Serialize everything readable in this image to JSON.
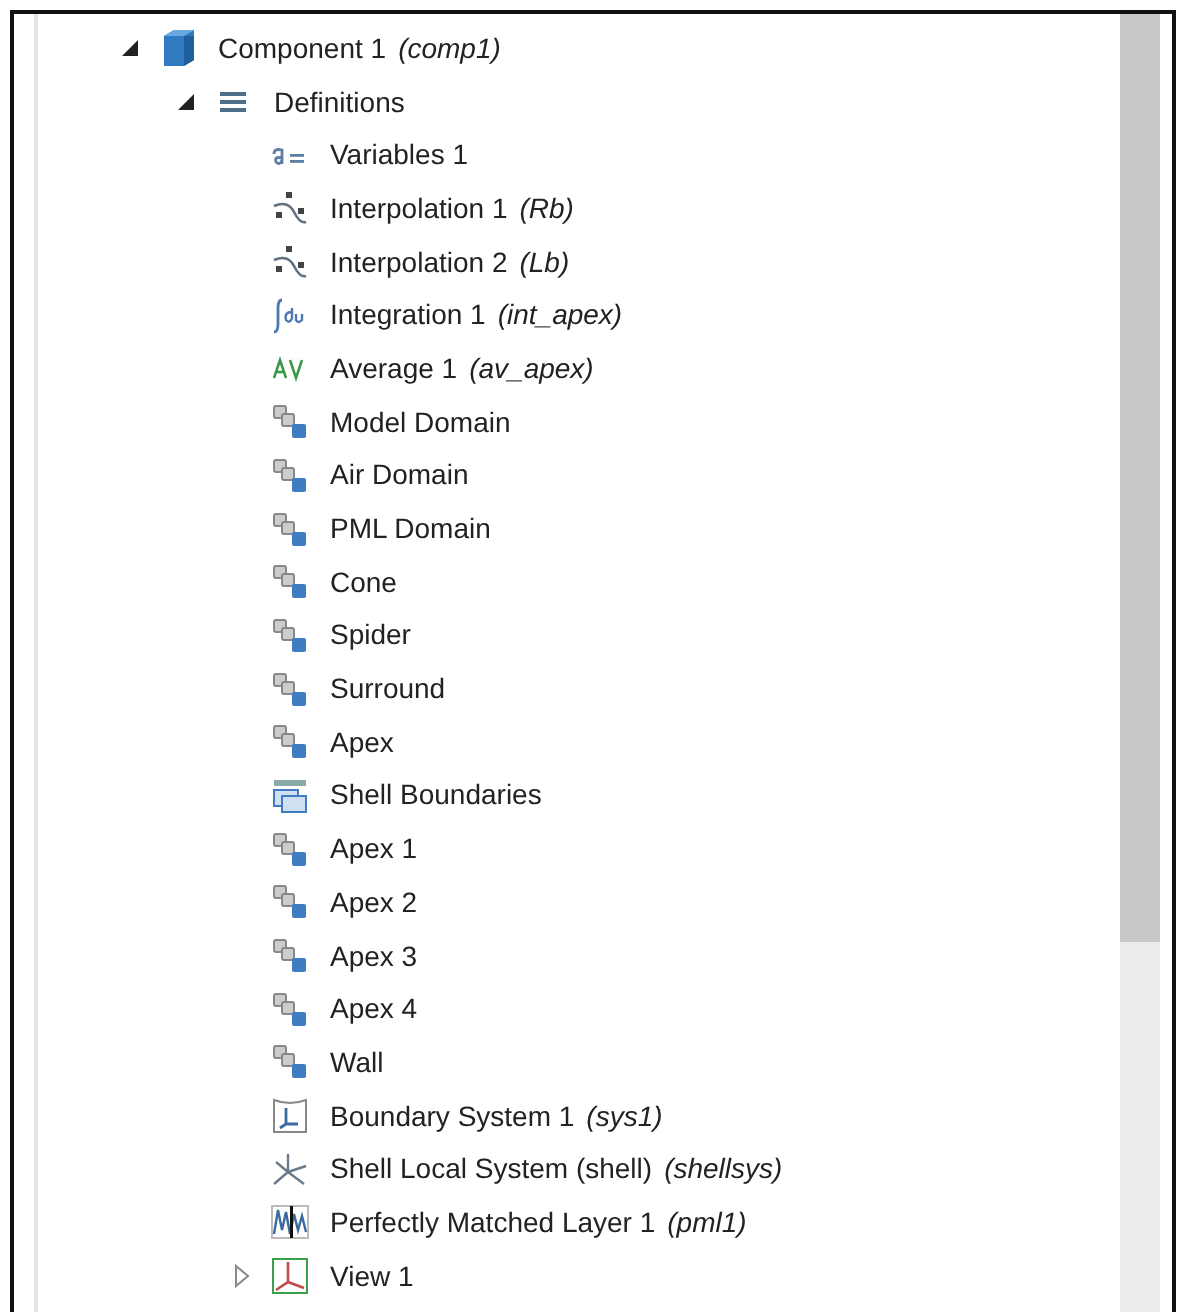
{
  "tree": [
    {
      "label": "Component 1",
      "tag": "(comp1)",
      "kind": "component",
      "expanded": true,
      "children": [
        {
          "label": "Definitions",
          "kind": "definitions",
          "expanded": true,
          "children": [
            {
              "label": "Variables 1",
              "kind": "variables"
            },
            {
              "label": "Interpolation 1",
              "tag": "(Rb)",
              "kind": "interpolation"
            },
            {
              "label": "Interpolation 2",
              "tag": "(Lb)",
              "kind": "interpolation"
            },
            {
              "label": "Integration 1",
              "tag": "(int_apex)",
              "kind": "integration"
            },
            {
              "label": "Average 1",
              "tag": "(av_apex)",
              "kind": "average"
            },
            {
              "label": "Model Domain",
              "kind": "selection"
            },
            {
              "label": "Air Domain",
              "kind": "selection"
            },
            {
              "label": "PML Domain",
              "kind": "selection"
            },
            {
              "label": "Cone",
              "kind": "selection"
            },
            {
              "label": "Spider",
              "kind": "selection"
            },
            {
              "label": "Surround",
              "kind": "selection"
            },
            {
              "label": "Apex",
              "kind": "selection"
            },
            {
              "label": "Shell Boundaries",
              "kind": "boundaries"
            },
            {
              "label": "Apex 1",
              "kind": "selection"
            },
            {
              "label": "Apex 2",
              "kind": "selection"
            },
            {
              "label": "Apex 3",
              "kind": "selection"
            },
            {
              "label": "Apex 4",
              "kind": "selection"
            },
            {
              "label": "Wall",
              "kind": "selection"
            },
            {
              "label": "Boundary System 1",
              "tag": "(sys1)",
              "kind": "boundary-system"
            },
            {
              "label": "Shell Local System (shell)",
              "tag": "(shellsys)",
              "kind": "local-system"
            },
            {
              "label": "Perfectly Matched Layer 1",
              "tag": "(pml1)",
              "kind": "pml"
            },
            {
              "label": "View 1",
              "kind": "view",
              "expanded": false
            }
          ]
        }
      ]
    }
  ]
}
